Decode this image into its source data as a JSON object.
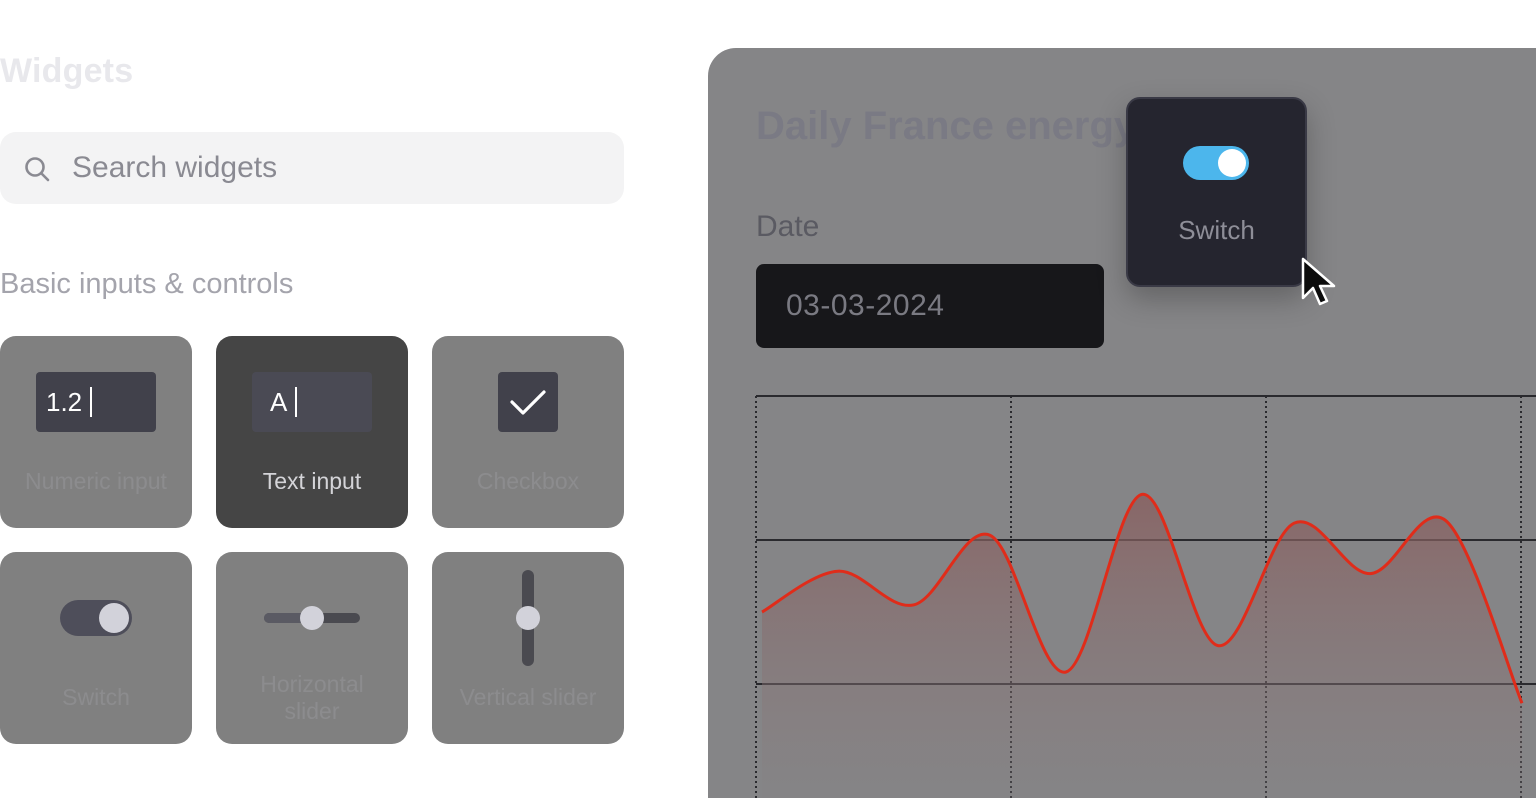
{
  "palette": {
    "title": "Widgets",
    "search": {
      "placeholder": "Search widgets",
      "value": ""
    },
    "section_title": "Basic inputs & controls",
    "tiles": [
      {
        "label": "Numeric input",
        "preview_value": "1.2",
        "icon": "numeric-input-icon"
      },
      {
        "label": "Text input",
        "preview_value": "A",
        "icon": "text-input-icon",
        "active": true
      },
      {
        "label": "Checkbox",
        "icon": "checkbox-icon"
      },
      {
        "label": "Switch",
        "icon": "switch-icon"
      },
      {
        "label": "Horizontal slider",
        "icon": "horizontal-slider-icon"
      },
      {
        "label": "Vertical slider",
        "icon": "vertical-slider-icon"
      }
    ]
  },
  "app": {
    "title": "Daily France energy",
    "date_label": "Date",
    "date_value": "03-03-2024",
    "line_color": "#e02c1a"
  },
  "drag_ghost": {
    "label": "Switch",
    "icon": "switch-icon",
    "accent": "#4cb6ec"
  },
  "chart_data": {
    "type": "area",
    "title": "",
    "xlabel": "",
    "ylabel": "",
    "grid": true,
    "series": [
      {
        "values": [
          0.3,
          0.47,
          0.33,
          0.62,
          0.05,
          0.79,
          0.16,
          0.67,
          0.46,
          0.68,
          -0.08
        ]
      }
    ]
  }
}
